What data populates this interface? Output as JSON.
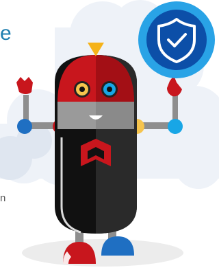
{
  "text_fragments": {
    "heading_tail": "e",
    "body_tail": "n"
  },
  "illustration": {
    "subject": "robot-mascot",
    "badge_icon": "shield-check-icon",
    "chest_logo": "mcafee-m-logo",
    "colors": {
      "cloud": "#eef2f8",
      "badge_ring": "#29a3e6",
      "badge_core": "#0c4fa8",
      "robot_red": "#c8161d",
      "robot_dark": "#1a1a1a",
      "robot_grey": "#9a9a9a",
      "joint_blue": "#1f6fc2",
      "joint_cyan": "#18a6e6",
      "joint_yellow": "#f6c44d",
      "antenna_yellow": "#f5b31a"
    }
  }
}
